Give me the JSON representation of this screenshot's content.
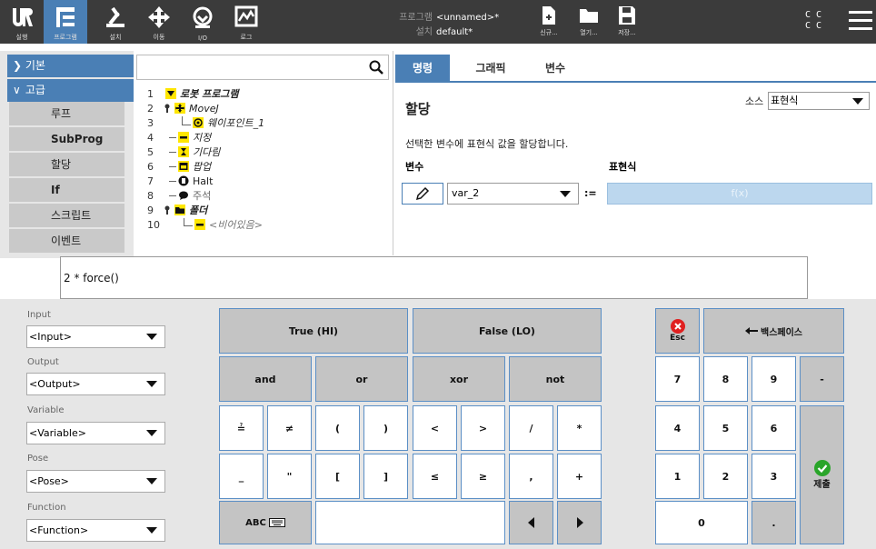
{
  "topbar": {
    "nav": [
      {
        "label": "실행",
        "icon": "ur-logo-icon"
      },
      {
        "label": "프로그램",
        "icon": "program-tree-icon"
      },
      {
        "label": "설치",
        "icon": "robot-arm-icon"
      },
      {
        "label": "이동",
        "icon": "move-arrows-icon"
      },
      {
        "label": "I/O",
        "icon": "io-icon"
      },
      {
        "label": "로그",
        "icon": "log-icon"
      }
    ],
    "program_key": "프로그램",
    "program_value": "<unnamed>*",
    "install_key": "설치",
    "install_value": "default*",
    "file_buttons": [
      {
        "label": "신규...",
        "icon": "new-file-icon"
      },
      {
        "label": "열기...",
        "icon": "open-folder-icon"
      },
      {
        "label": "저장...",
        "icon": "save-icon"
      }
    ],
    "cc_line1": "C C",
    "cc_line2": "C C",
    "accent": "#4a7fb5"
  },
  "leftnav": {
    "basic": "기본",
    "advanced": "고급",
    "items": [
      "루프",
      "SubProg",
      "할당",
      "If",
      "스크립트",
      "이벤트"
    ]
  },
  "tree": {
    "rows": [
      {
        "no": "1",
        "label": "로봇 프로그램"
      },
      {
        "no": "2",
        "label": "MoveJ"
      },
      {
        "no": "3",
        "label": "웨이포인트_1"
      },
      {
        "no": "4",
        "label": "지정"
      },
      {
        "no": "5",
        "label": "기다림"
      },
      {
        "no": "6",
        "label": "팝업"
      },
      {
        "no": "7",
        "label": "Halt"
      },
      {
        "no": "8",
        "label": "주석"
      },
      {
        "no": "9",
        "label": "폴더"
      },
      {
        "no": "10",
        "label": "<비어있음>"
      }
    ]
  },
  "tabs": [
    "명령",
    "그래픽",
    "변수"
  ],
  "assign": {
    "title": "할당",
    "source_label": "소스",
    "source_value": "표현식",
    "description": "선택한 변수에 표현식 값을 할당합니다.",
    "var_label": "변수",
    "expr_label": "표현식",
    "var_value": "var_2",
    "operator": ":=",
    "expr_placeholder": "f(x)"
  },
  "expression_input": "2 * force()",
  "side": [
    {
      "label": "Input",
      "value": "<Input>"
    },
    {
      "label": "Output",
      "value": "<Output>"
    },
    {
      "label": "Variable",
      "value": "<Variable>"
    },
    {
      "label": "Pose",
      "value": "<Pose>"
    },
    {
      "label": "Function",
      "value": "<Function>"
    }
  ],
  "keys": {
    "true_hi": "True (HI)",
    "false_lo": "False (LO)",
    "and": "and",
    "or": "or",
    "xor": "xor",
    "not": "not",
    "row3": [
      "≟",
      "≠",
      "(",
      ")",
      "<",
      ">",
      "/",
      "*"
    ],
    "row4": [
      "_",
      "\"",
      "[",
      "]",
      "≤",
      "≥",
      ",",
      "+"
    ],
    "abc": "ABC",
    "esc": "Esc",
    "backspace": "백스페이스",
    "num1": [
      "7",
      "8",
      "9",
      "-"
    ],
    "num2": [
      "4",
      "5",
      "6"
    ],
    "num3": [
      "1",
      "2",
      "3"
    ],
    "zero": "0",
    "dot": ".",
    "submit": "제출"
  }
}
